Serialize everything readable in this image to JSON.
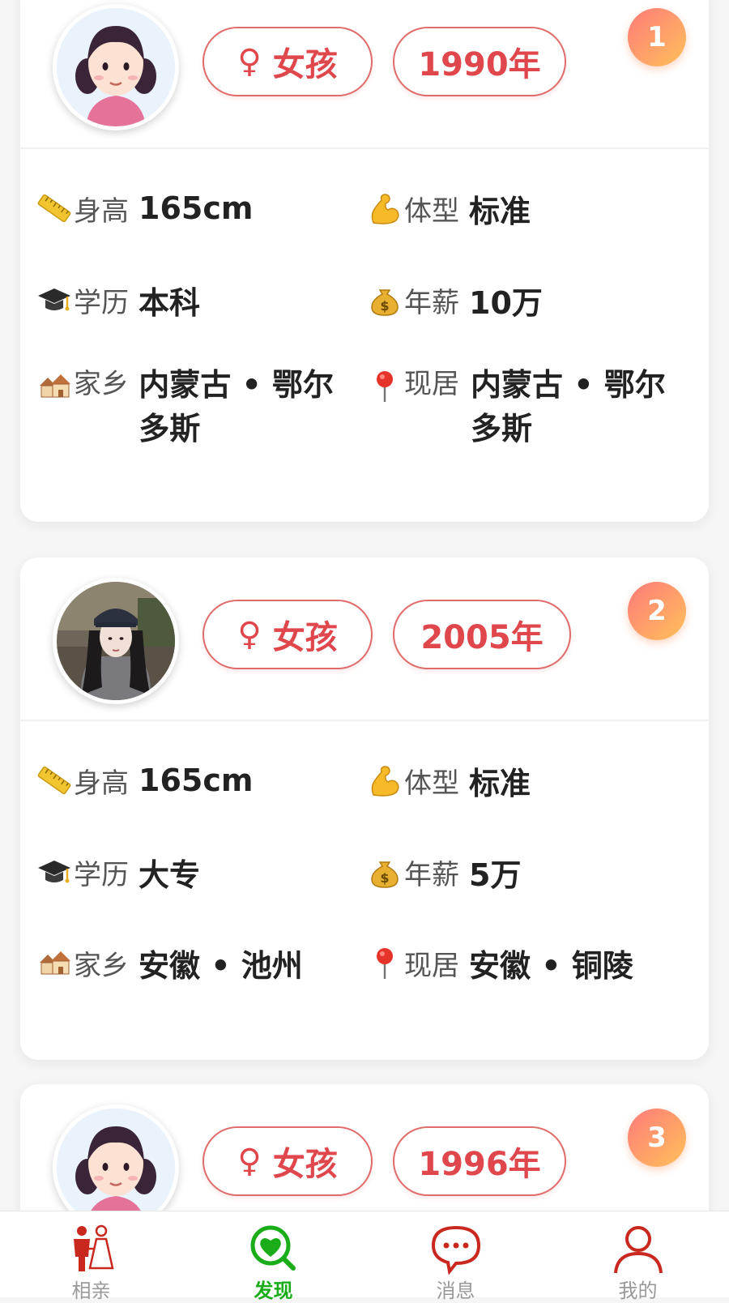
{
  "colors": {
    "accent_red": "#e0474c",
    "tab_active": "#1aad19",
    "tab_inactive": "#999999"
  },
  "cards": [
    {
      "rank": "1",
      "avatar": "cartoon-girl-avatar",
      "gender_symbol": "♀",
      "gender": "女孩",
      "year": "1990年",
      "height_label": "身高",
      "height": "165cm",
      "body_label": "体型",
      "body": "标准",
      "edu_label": "学历",
      "edu": "本科",
      "salary_label": "年薪",
      "salary": "10万",
      "hometown_label": "家乡",
      "hometown": "内蒙古 • 鄂尔多斯",
      "residence_label": "现居",
      "residence": "内蒙古 • 鄂尔多斯"
    },
    {
      "rank": "2",
      "avatar": "photo-avatar",
      "gender_symbol": "♀",
      "gender": "女孩",
      "year": "2005年",
      "height_label": "身高",
      "height": "165cm",
      "body_label": "体型",
      "body": "标准",
      "edu_label": "学历",
      "edu": "大专",
      "salary_label": "年薪",
      "salary": "5万",
      "hometown_label": "家乡",
      "hometown": "安徽 • 池州",
      "residence_label": "现居",
      "residence": "安徽 • 铜陵"
    },
    {
      "rank": "3",
      "avatar": "cartoon-girl-avatar",
      "gender_symbol": "♀",
      "gender": "女孩",
      "year": "1996年"
    }
  ],
  "tabs": [
    {
      "label": "相亲",
      "icon": "couple-icon",
      "active": false
    },
    {
      "label": "发现",
      "icon": "discover-icon",
      "active": true
    },
    {
      "label": "消息",
      "icon": "message-icon",
      "active": false
    },
    {
      "label": "我的",
      "icon": "profile-icon",
      "active": false
    }
  ]
}
